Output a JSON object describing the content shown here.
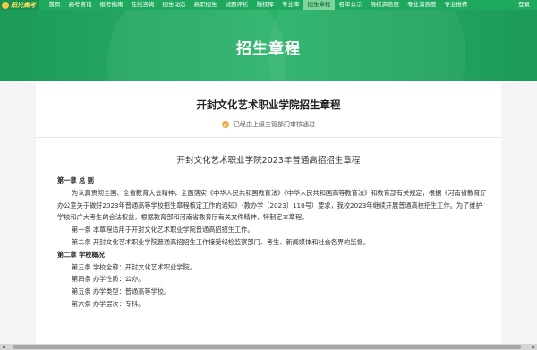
{
  "nav": {
    "logo": "阳光高考",
    "items": [
      "首页",
      "高考资讯",
      "报考指南",
      "在线咨询",
      "招生动态",
      "高职招生",
      "试题评析",
      "院校库",
      "专业库",
      "招生章程",
      "名单公示",
      "院校满意度",
      "专业满意度",
      "专业推荐"
    ],
    "active_index": 9,
    "login": "登录"
  },
  "hero": {
    "title": "招生章程"
  },
  "article": {
    "title": "开封文化艺术职业学院招生章程",
    "verify_note": "已经由上级主管部门审核通过",
    "doc_title": "开封文化艺术职业学院2023年普通高招招生章程"
  },
  "body": {
    "ch1": "第一章 总 则",
    "p1": "为认真贯彻全国、全省教育大会精神，全面落实《中华人民共和国教育法》《中华人民共和国高等教育法》和教育部有关规定，根据《河南省教育厅办公室关于做好2023年普通高等学校招生章程核定工作的通知》（教办学〔2023〕110号）要求，我校2023年继续开展普通高校招生工作。为了维护学校和广大考生的合法权益，根据教育部和河南省教育厅有关文件精神，特制定本章程。",
    "a1": "第一条 本章程适用于开封文化艺术职业学院普通高招招生工作。",
    "a2": "第二条 开封文化艺术职业学院普通高招招生工作接受纪检监察部门、考生、新闻媒体和社会各界的监督。",
    "ch2": "第二章 学校概况",
    "a3": "第三条 学校全称：开封文化艺术职业学院。",
    "a4": "第四条 办学性质：公办。",
    "a5": "第五条 办学类型：普通高等学校。",
    "a6": "第六条 办学层次：专科。"
  }
}
